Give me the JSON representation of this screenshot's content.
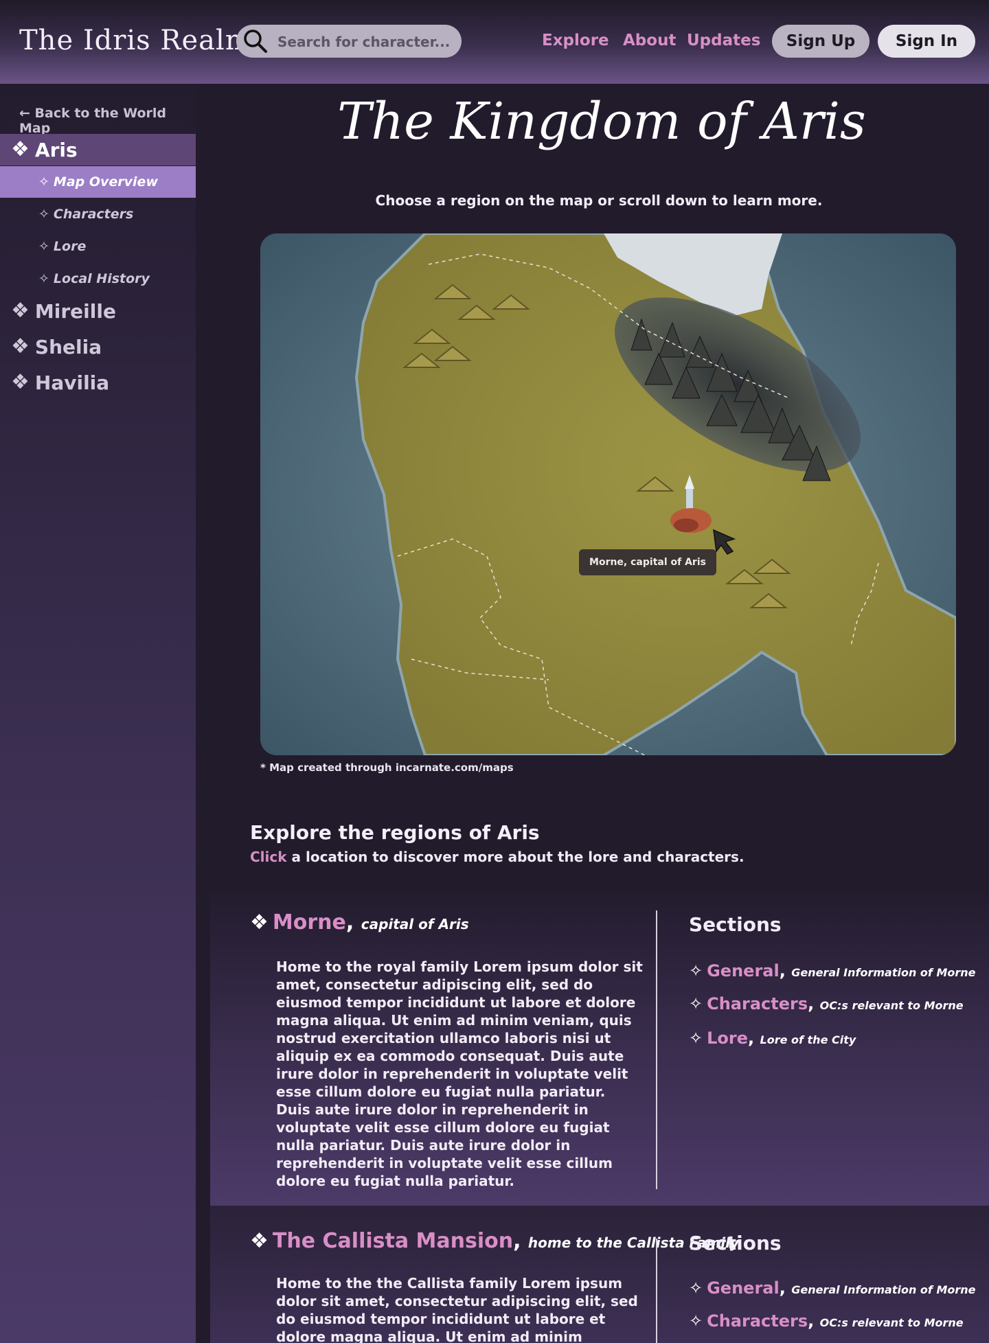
{
  "header": {
    "logo": "The Idris Realm",
    "search_placeholder": "Search for character...",
    "nav": [
      "Explore",
      "About",
      "Updates"
    ],
    "sign_up": "Sign Up",
    "sign_in": "Sign In"
  },
  "sidebar": {
    "back": "← Back to the World Map",
    "regions": [
      {
        "label": "Aris",
        "active": true,
        "children": [
          "Map Overview",
          "Characters",
          "Lore",
          "Local History"
        ]
      },
      {
        "label": "Mireille"
      },
      {
        "label": "Shelia"
      },
      {
        "label": "Havilia"
      }
    ],
    "active_child": "Map Overview"
  },
  "main": {
    "title": "The Kingdom of Aris",
    "subtitle": "Choose a region on the map or scroll down to learn more.",
    "map_tooltip": "Morne, capital of Aris",
    "map_credit": "* Map created through incarnate.com/maps",
    "explore_title": "Explore the regions of Aris",
    "explore_accent": "Click",
    "explore_rest": " a location to discover more about the lore and characters."
  },
  "regions": [
    {
      "name": "Morne",
      "tagline": "capital of Aris",
      "paragraphs": [
        "Home to the royal family  Lorem ipsum dolor sit amet, consectetur adipiscing elit, sed do eiusmod tempor incididunt ut labore et dolore magna aliqua. Ut enim ad minim veniam, quis nostrud exercitation ullamco laboris nisi ut aliquip ex ea commodo consequat. Duis aute irure dolor in reprehenderit in voluptate velit esse cillum dolore eu fugiat nulla pariatur.",
        "Duis aute irure dolor in reprehenderit in voluptate velit esse cillum dolore eu fugiat nulla pariatur. Duis aute irure dolor in reprehenderit in voluptate velit esse cillum dolore eu fugiat nulla pariatur."
      ],
      "sections_title": "Sections",
      "sections": [
        {
          "label": "General",
          "desc": "General Information of Morne"
        },
        {
          "label": "Characters",
          "desc": "OC:s relevant to Morne"
        },
        {
          "label": "Lore",
          "desc": "Lore of the City"
        }
      ]
    },
    {
      "name": "The Callista Mansion",
      "tagline": "home to the Callista Family",
      "paragraphs": [
        "Home to the the Callista family Lorem ipsum dolor sit amet, consectetur adipiscing elit, sed do eiusmod tempor incididunt ut labore et dolore magna aliqua. Ut enim ad minim veniam, quis nostrud exercitation"
      ],
      "sections_title": "Sections",
      "sections": [
        {
          "label": "General",
          "desc": "General Information of Morne"
        },
        {
          "label": "Characters",
          "desc": "OC:s relevant to Morne"
        }
      ]
    }
  ],
  "colors": {
    "accent": "#d88fc6",
    "sidebar_active": "#5e4676",
    "sidebar_sub_active": "#9b7ec6",
    "background": "#221b2c"
  },
  "icons": {
    "search": "search-icon",
    "region_bullet": "diamond-cluster-icon",
    "sub_bullet": "four-point-star-icon",
    "map_cursor": "cursor-arrow-icon"
  }
}
